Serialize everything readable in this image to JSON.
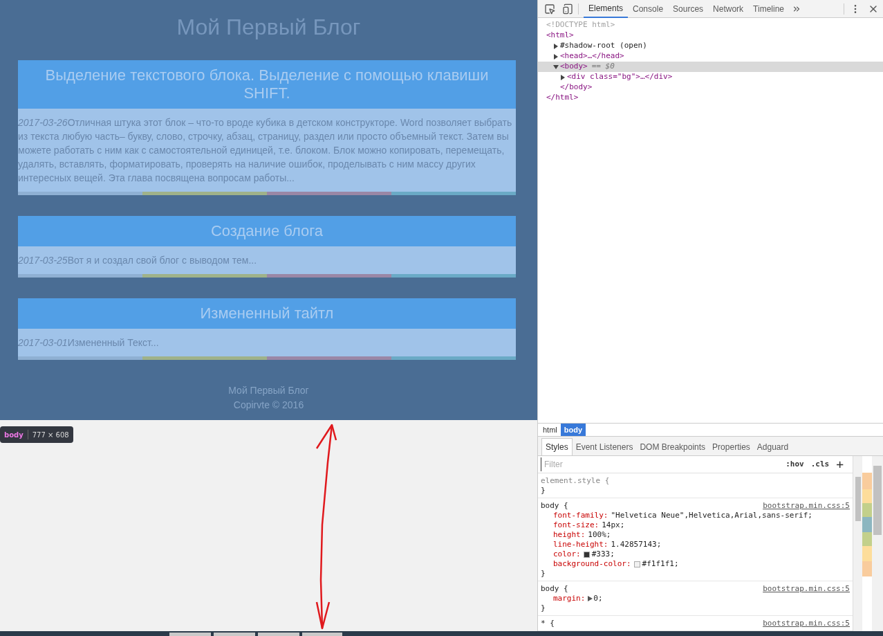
{
  "page": {
    "blog_title": "Мой Первый Блог",
    "posts": [
      {
        "title": "Выделение текстового блока. Выделение с помощью клавиши SHIFT.",
        "date": "2017-03-26",
        "excerpt": "Отличная штука этот блок – что-то вроде кубика в детском конструкторе. Word позволяет выбрать из текста любую часть– букву, слово, строчку, абзац, страницу, раздел или просто объемный текст. Затем вы можете работать с ним как с самостоятельной единицей, т.е. блоком. Блок можно копировать, перемещать, удалять, вставлять, форматировать, проверять на наличие ошибок, проделывать с ним массу других интересных вещей. Эта глава посвящена вопросам работы..."
      },
      {
        "title": "Создание блога",
        "date": "2017-03-25",
        "excerpt": "Вот я и создал свой блог с выводом тем..."
      },
      {
        "title": "Измененный тайтл",
        "date": "2017-03-01",
        "excerpt": "Измененный Текст..."
      }
    ],
    "footer_lines": [
      "Мой Первый Блог",
      "Copirvte © 2016"
    ],
    "inspect_badge": {
      "tag": "body",
      "size": "777 × 608"
    }
  },
  "devtools": {
    "tabs": [
      {
        "label": "Elements",
        "selected": true
      },
      {
        "label": "Console",
        "selected": false
      },
      {
        "label": "Sources",
        "selected": false
      },
      {
        "label": "Network",
        "selected": false
      },
      {
        "label": "Timeline",
        "selected": false
      }
    ],
    "dom_tree": [
      {
        "kind": "doctype",
        "text": "<!DOCTYPE html>"
      },
      {
        "kind": "tag",
        "text": "<html>",
        "close": "</html>",
        "children": [
          {
            "kind": "shadow",
            "text": "#shadow-root (open)",
            "expanded": false
          },
          {
            "kind": "tag",
            "text": "<head>…</head>",
            "expanded": false
          },
          {
            "kind": "tag",
            "text": "<body>",
            "suffix": "== $0",
            "selected": true,
            "expanded": true,
            "close": "</body>",
            "children": [
              {
                "kind": "tag",
                "text": "<div class=\"bg\">…</div>",
                "expanded": false
              }
            ]
          }
        ]
      }
    ],
    "breadcrumbs": [
      {
        "label": "html",
        "selected": false
      },
      {
        "label": "body",
        "selected": true
      }
    ],
    "sidebar_tabs": [
      {
        "label": "Styles",
        "selected": true
      },
      {
        "label": "Event Listeners",
        "selected": false
      },
      {
        "label": "DOM Breakpoints",
        "selected": false
      },
      {
        "label": "Properties",
        "selected": false
      },
      {
        "label": "Adguard",
        "selected": false
      }
    ],
    "filter": {
      "placeholder": "Filter"
    },
    "filter_buttons": [
      ":hov",
      ".cls",
      "+"
    ],
    "rules": [
      {
        "selector": "element.style {",
        "close": "}"
      },
      {
        "selector": "body {",
        "source": "bootstrap.min.css:5",
        "close": "}",
        "declarations": [
          {
            "property": "font-family:",
            "value": "\"Helvetica Neue\",Helvetica,Arial,sans-serif;"
          },
          {
            "property": "font-size:",
            "value": "14px;"
          },
          {
            "property": "height:",
            "value": "100%;"
          },
          {
            "property": "line-height:",
            "value": "1.42857143;"
          },
          {
            "property": "color:",
            "value": "#333;",
            "color": "#333333"
          },
          {
            "property": "background-color:",
            "value": "#f1f1f1;",
            "color": "#f1f1f1"
          }
        ]
      },
      {
        "selector": "body {",
        "source": "bootstrap.min.css:5",
        "close": "}",
        "declarations": [
          {
            "property": "margin:",
            "value": "0;",
            "kind": "shorthand"
          }
        ]
      },
      {
        "selector": "* {",
        "source": "bootstrap.min.css:5"
      }
    ]
  }
}
